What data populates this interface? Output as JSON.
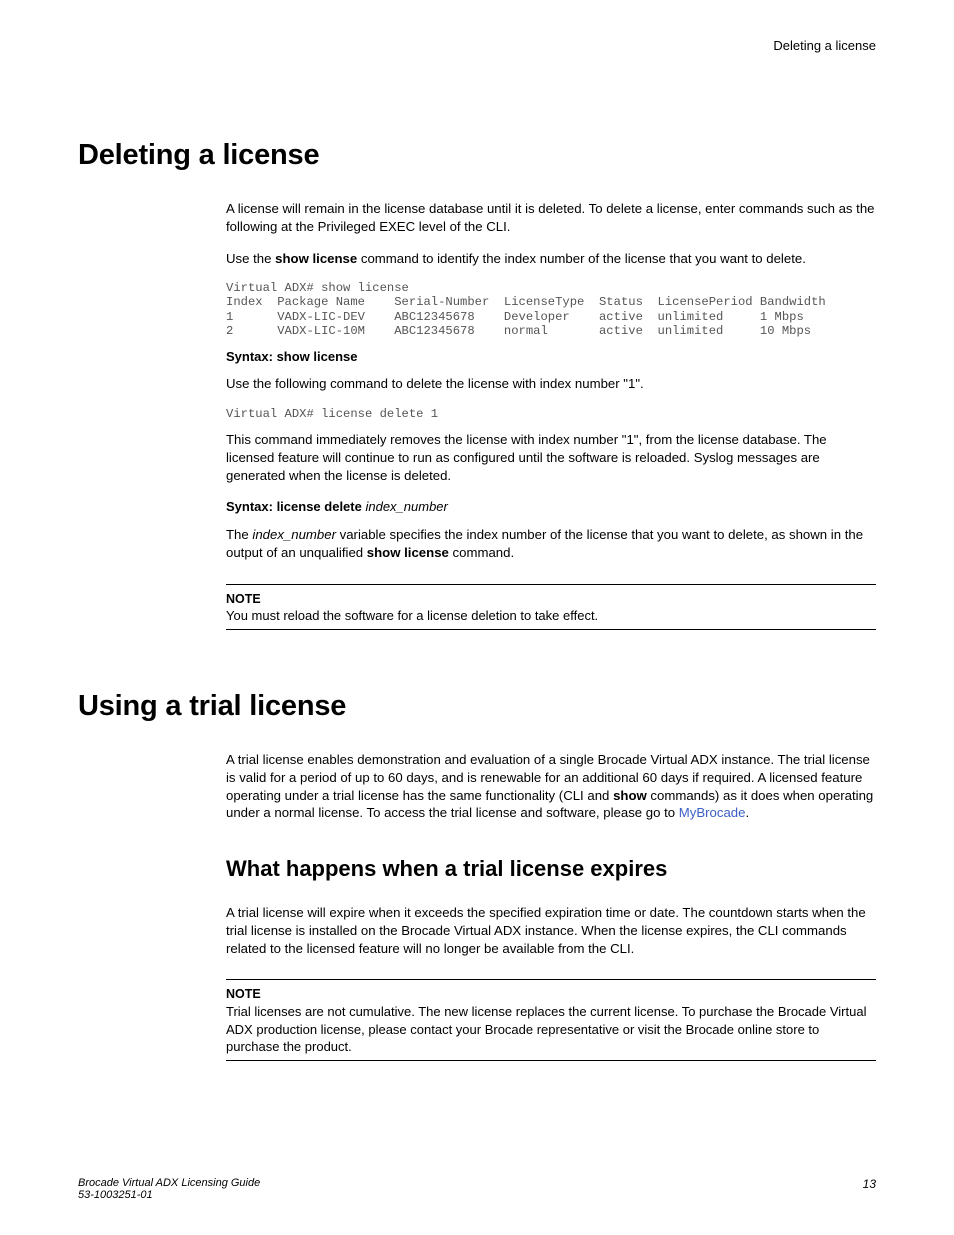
{
  "running_head": "Deleting a license",
  "sections": {
    "deleting": {
      "title": "Deleting a license",
      "p1": "A license will remain in the license database until it is deleted. To delete a license, enter commands such as the following at the Privileged EXEC level of the CLI.",
      "p2_pre": "Use the ",
      "p2_cmd": "show license",
      "p2_post": " command to identify the index number of the license that you want to delete.",
      "cli1": "Virtual ADX# show license\nIndex  Package Name    Serial-Number  LicenseType  Status  LicensePeriod Bandwidth\n1      VADX-LIC-DEV    ABC12345678    Developer    active  unlimited     1 Mbps\n2      VADX-LIC-10M    ABC12345678    normal       active  unlimited     10 Mbps",
      "syntax1": "Syntax: show license",
      "p3": "Use the following command to delete the license with index number \"1\".",
      "cli2": "Virtual ADX# license delete 1",
      "p4": "This command immediately removes the license with index number \"1\", from the license database. The licensed feature will continue to run as configured until the software is reloaded. Syslog messages are generated when the license is deleted.",
      "syntax2_label": "Syntax: license delete",
      "syntax2_arg": "index_number",
      "p5_pre": "The ",
      "p5_var": "index_number",
      "p5_mid": " variable specifies the index number of the license that you want to delete, as shown in the output of an unqualified ",
      "p5_cmd": "show license",
      "p5_post": " command.",
      "note_label": "NOTE",
      "note_text": "You must reload the software for a license deletion to take effect."
    },
    "trial": {
      "title": "Using a trial license",
      "p1_pre": "A trial license enables demonstration and evaluation of a single Brocade Virtual ADX instance. The trial license is valid for a period of up to 60 days, and is renewable for an additional 60 days if required. A licensed feature operating under a trial license has the same functionality (CLI and ",
      "p1_cmd": "show",
      "p1_mid": " commands) as it does when operating under a normal license. To access the trial license and software, please go to ",
      "p1_link": "MyBrocade",
      "p1_post": ".",
      "sub_title": "What happens when a trial license expires",
      "p2": "A trial license will expire when it exceeds the specified expiration time or date. The countdown starts when the trial license is installed on the Brocade Virtual ADX instance. When the license expires, the CLI commands related to the licensed feature will no longer be available from the CLI.",
      "note_label": "NOTE",
      "note_text": "Trial licenses are not cumulative. The new license replaces the current license. To purchase the Brocade Virtual ADX production license, please contact your Brocade representative or visit the Brocade online store to purchase the product."
    }
  },
  "footer": {
    "doc_title": "Brocade Virtual ADX Licensing Guide",
    "doc_number": "53-1003251-01",
    "page": "13"
  }
}
